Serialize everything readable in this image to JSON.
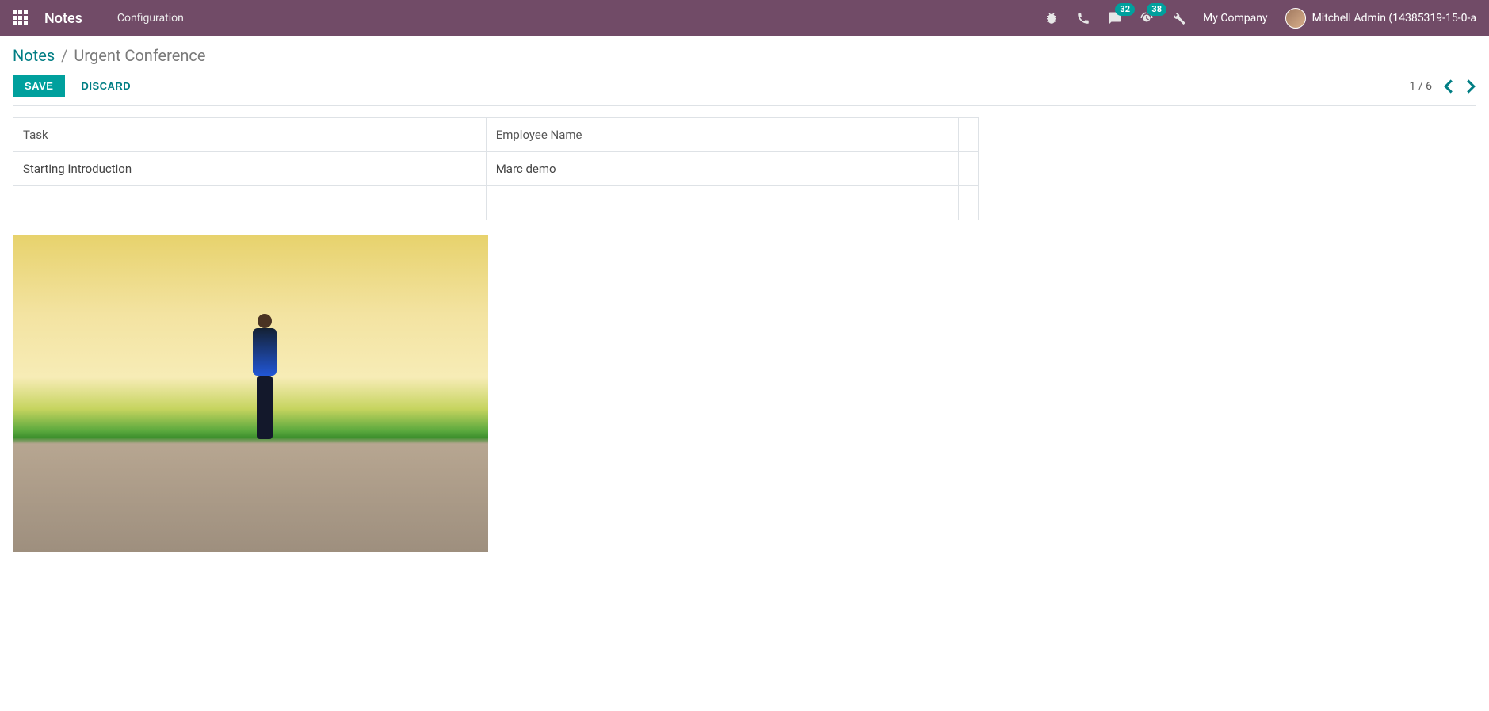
{
  "header": {
    "app_name": "Notes",
    "config_link": "Configuration",
    "company": "My Company",
    "user_name": "Mitchell Admin (14385319-15-0-a",
    "badges": {
      "messages": "32",
      "activities": "38"
    }
  },
  "breadcrumb": {
    "root": "Notes",
    "sep": "/",
    "current": "Urgent Conference"
  },
  "buttons": {
    "save": "SAVE",
    "discard": "DISCARD"
  },
  "pager": {
    "text": "1 / 6"
  },
  "table": {
    "headers": {
      "col1": "Task",
      "col2": "Employee Name"
    },
    "rows": [
      {
        "task": "Starting Introduction",
        "employee": "Marc demo"
      },
      {
        "task": " ",
        "employee": " "
      }
    ]
  }
}
